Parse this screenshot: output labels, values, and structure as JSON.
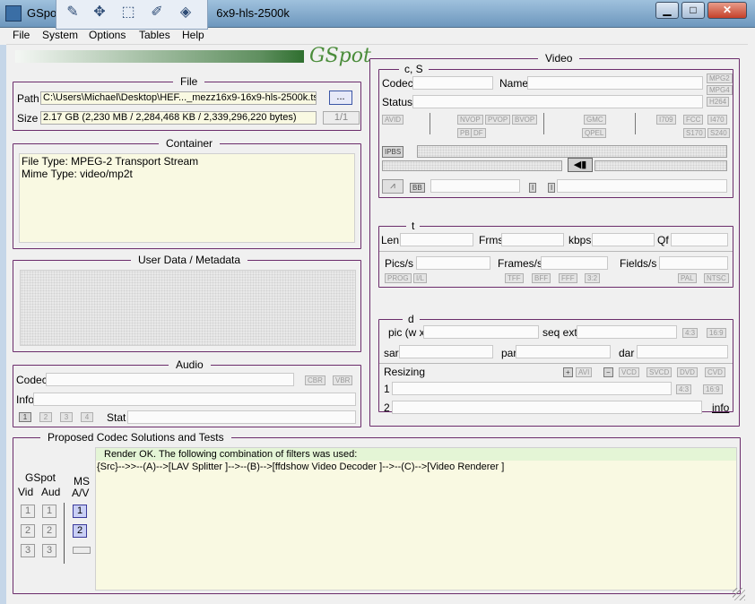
{
  "window": {
    "title_left": "GSpo",
    "title_right": "6x9-hls-2500k",
    "min_label": "▁",
    "max_label": "□",
    "close_label": "✕"
  },
  "menu": [
    "File",
    "System",
    "Options",
    "Tables",
    "Help"
  ],
  "logo_text": "GSpot",
  "file_box": {
    "title": "File",
    "path_label": "Path",
    "path_value": "C:\\Users\\Michael\\Desktop\\HEF..._mezz16x9-16x9-hls-2500k.ts",
    "browse_label": "...",
    "size_label": "Size",
    "size_value": "2.17 GB (2,230 MB / 2,284,468 KB / 2,339,296,220 bytes)",
    "page_value": "1/1"
  },
  "container_box": {
    "title": "Container",
    "lines": [
      "File Type: MPEG-2 Transport Stream",
      "Mime Type: video/mp2t"
    ]
  },
  "userdata_box": {
    "title": "User Data / Metadata"
  },
  "audio_box": {
    "title": "Audio",
    "codec_label": "Codec",
    "cbr": "CBR",
    "vbr": "VBR",
    "info_label": "Info",
    "stat_label": "Stat",
    "stream_nums": [
      "1",
      "2",
      "3",
      "4"
    ]
  },
  "codec_box": {
    "title": "Proposed Codec Solutions and Tests",
    "gspot_label": "GSpot",
    "vid_label": "Vid",
    "aud_label": "Aud",
    "ms_label": "MS",
    "av_label": "A/V",
    "nums": [
      "1",
      "2",
      "3"
    ],
    "ms_nums": [
      "1",
      "2"
    ],
    "render_ok": "Render OK. The following combination of filters was used:",
    "filter_chain": "{Src}-->>--(A)-->[LAV Splitter ]-->--(B)-->[ffdshow Video Decoder ]-->--(C)-->[Video Renderer ]"
  },
  "video_box": {
    "title": "Video",
    "cs_title": "c, S",
    "codec_label": "Codec",
    "name_label": "Name",
    "status_label": "Status",
    "mpg_chips": [
      "MPG2",
      "MPG4",
      "H264"
    ],
    "avid": "AVID",
    "nvop": "NVOP",
    "pvop": "PVOP",
    "bvop": "BVOP",
    "pb": "PB",
    "df": "DF",
    "gmc": "GMC",
    "qpel": "QPEL",
    "i709": "I709",
    "fcc": "FCC",
    "i470": "I470",
    "s170": "S170",
    "s240": "S240",
    "ipbs": "IPBS",
    "bb": "BB",
    "i1": "I",
    "i2": "I",
    "t_title": "t",
    "len_label": "Len",
    "frms_label": "Frms",
    "kbps_label": "kbps",
    "qf_label": "Qf",
    "pics_label": "Pics/s",
    "frames_label": "Frames/s",
    "fields_label": "Fields/s",
    "prog": "PROG",
    "il": "I/L",
    "tff": "TFF",
    "bff": "BFF",
    "fff": "FFF",
    "s32": "3:2",
    "pal": "PAL",
    "ntsc": "NTSC",
    "d_title": "d",
    "pic_label": "pic (w x",
    "seqext_label": "seq ext",
    "r43": "4:3",
    "r169": "16:9",
    "sar_label": "sar",
    "par_label": "par",
    "dar_label": "dar",
    "resizing_label": "Resizing",
    "plus": "+",
    "avi": "AVI",
    "minus": "−",
    "vcd": "VCD",
    "svcd": "SVCD",
    "dvd": "DVD",
    "cvd": "CVD",
    "row1": "1",
    "row2": "2",
    "r43b": "4:3",
    "r169b": "16:9",
    "info_link": "info"
  },
  "colors": {
    "frame_border": "#6b2c6b",
    "title_bar": "#8db1d4",
    "field_yellow": "#f9f9e2",
    "render_green": "#e4f5d6"
  }
}
